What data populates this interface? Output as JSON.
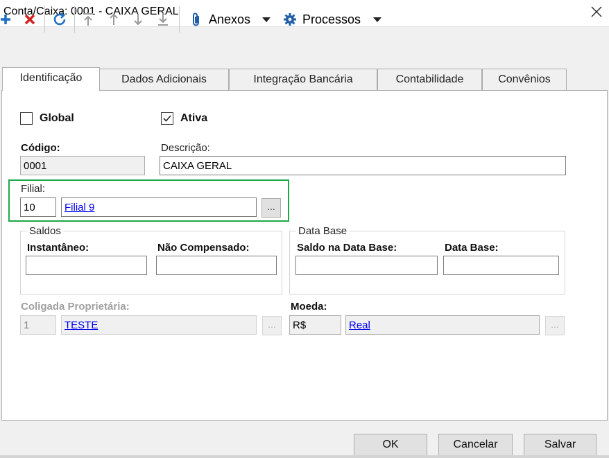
{
  "window": {
    "title": "Conta/Caixa: 0001 - CAIXA GERAL"
  },
  "toolbar": {
    "icons": [
      "add-icon",
      "delete-icon",
      "refresh-icon",
      "move-first-icon",
      "move-up-icon",
      "move-down-icon",
      "move-last-icon",
      "paperclip-icon",
      "gear-icon"
    ],
    "anexos_label": "Anexos",
    "processos_label": "Processos",
    "colors": {
      "add": "#1f6fc0",
      "delete": "#d42020",
      "refresh": "#1f6fc0",
      "disabled": "#9a9a9a",
      "gear": "#1f5fa8"
    }
  },
  "tabs": [
    {
      "label": "Identificação",
      "active": true
    },
    {
      "label": "Dados Adicionais",
      "active": false
    },
    {
      "label": "Integração Bancária",
      "active": false
    },
    {
      "label": "Contabilidade",
      "active": false
    },
    {
      "label": "Convênios",
      "active": false
    }
  ],
  "form": {
    "global": {
      "label": "Global",
      "checked": false
    },
    "ativa": {
      "label": "Ativa",
      "checked": true
    },
    "codigo": {
      "label": "Código:",
      "value": "0001"
    },
    "descricao": {
      "label": "Descrição:",
      "value": "CAIXA GERAL"
    },
    "filial": {
      "label": "Filial:",
      "code": "10",
      "name": "Filial 9",
      "button": "...",
      "highlight_color": "#1ea84a"
    },
    "saldos": {
      "title": "Saldos",
      "instantaneo_label": "Instantâneo:",
      "instantaneo_value": "",
      "nao_compensado_label": "Não Compensado:",
      "nao_compensado_value": ""
    },
    "data_base": {
      "title": "Data Base",
      "saldo_label": "Saldo na Data Base:",
      "saldo_value": "",
      "data_label": "Data Base:",
      "data_value": ""
    },
    "coligada": {
      "label": "Coligada Proprietária:",
      "code": "1",
      "name": "TESTE",
      "button": "..."
    },
    "moeda": {
      "label": "Moeda:",
      "code": "R$",
      "name": "Real",
      "button": "..."
    }
  },
  "buttons": {
    "ok": "OK",
    "cancelar": "Cancelar",
    "salvar": "Salvar"
  }
}
